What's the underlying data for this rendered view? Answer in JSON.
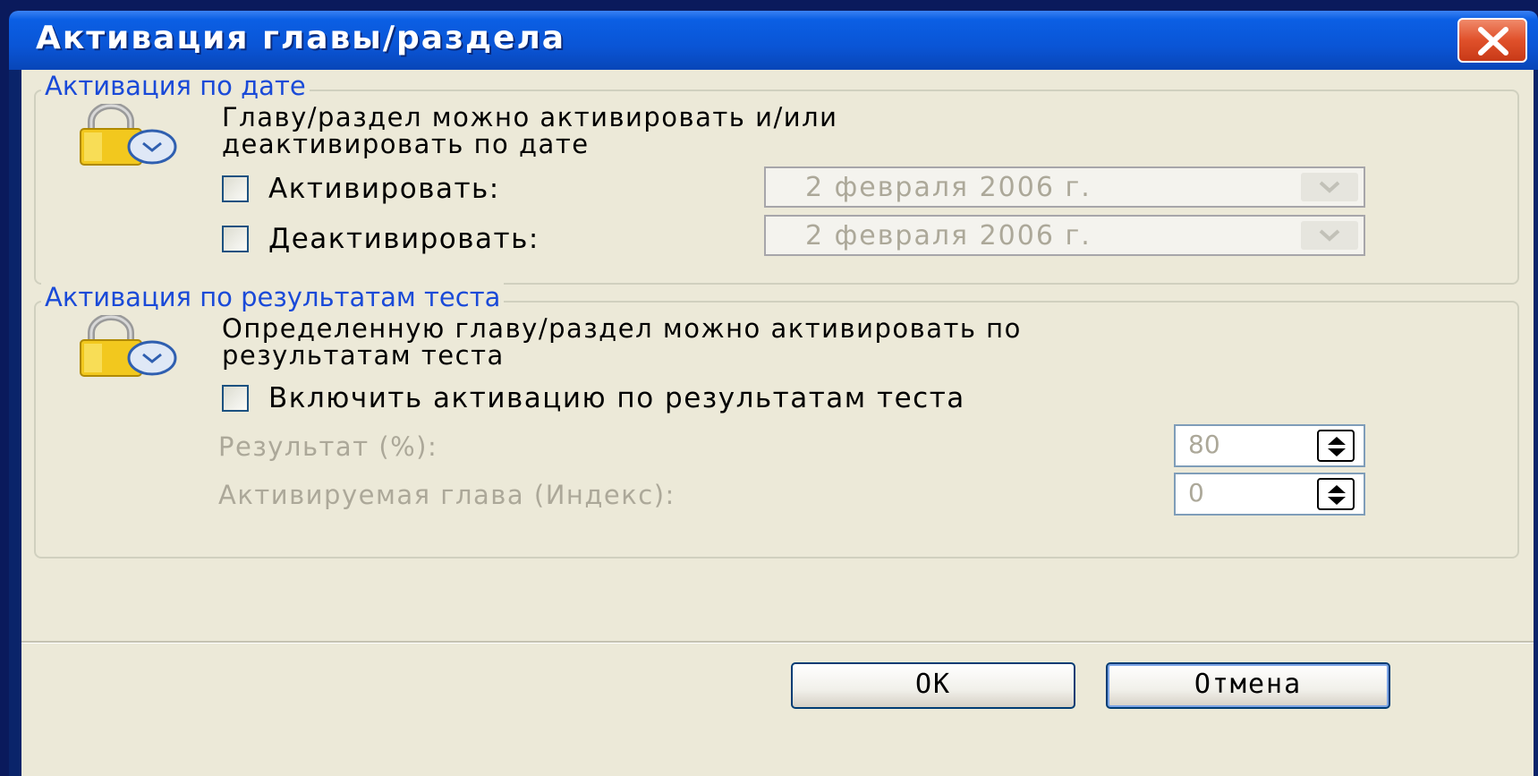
{
  "window": {
    "title": "Активация главы/раздела"
  },
  "date_group": {
    "legend": "Активация по дате",
    "description_line1": "Главу/раздел можно активировать и/или",
    "description_line2": "деактивировать по дате",
    "activate_label": "Активировать:",
    "deactivate_label": "Деактивировать:",
    "activate_checked": false,
    "deactivate_checked": false,
    "activate_date": "2 февраля 2006 г.",
    "deactivate_date": "2 февраля 2006 г."
  },
  "test_group": {
    "legend": "Активация по результатам теста",
    "description_line1": "Определенную главу/раздел можно активировать по",
    "description_line2": "результатам теста",
    "enable_label": "Включить активацию по результатам теста",
    "enable_checked": false,
    "result_label": "Результат (%):",
    "result_value": "80",
    "chapter_label": "Активируемая глава (Индекс):",
    "chapter_value": "0"
  },
  "buttons": {
    "ok": "OK",
    "cancel": "Отмена"
  },
  "icons": {
    "lock": "lock-clock-icon",
    "close": "close-icon",
    "dropdown": "chevron-down-icon",
    "spinner": "spinner-arrows-icon"
  },
  "colors": {
    "titlebar": "#0a55d6",
    "legend_text": "#1a4ad8",
    "client_bg": "#ece9d8",
    "disabled_text": "#aca899"
  }
}
